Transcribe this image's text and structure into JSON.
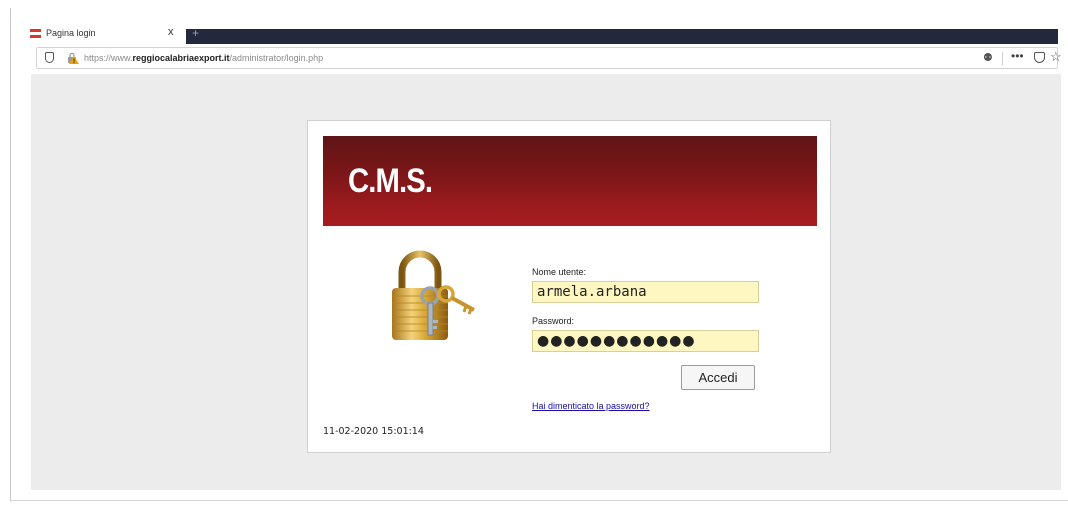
{
  "browser": {
    "tab": {
      "title": "Pagina login",
      "close_glyph": "x",
      "new_tab_glyph": "+"
    },
    "url": {
      "prefix": "https://www.",
      "domain": "reggiocalabriaexport.it",
      "path": "/administrator/login.php"
    },
    "toolbar": {
      "more_glyph": "•••",
      "star_glyph": "☆",
      "bulb_glyph": "⚉"
    },
    "colors": {
      "tab_bar_dark": "#23283f",
      "favicon_red": "#d9352b"
    }
  },
  "login": {
    "banner_title": "C.M.S.",
    "username_label": "Nome utente:",
    "username_value": "armela.arbana",
    "password_label": "Password:",
    "password_value": "●●●●●●●●●●●●",
    "submit_label": "Accedi",
    "forgot_link": "Hai dimenticato la password?",
    "timestamp": "11-02-2020 15:01:14",
    "colors": {
      "banner": "#8a181b",
      "field_bg": "#fff7c2",
      "link": "#1a0dab"
    }
  }
}
